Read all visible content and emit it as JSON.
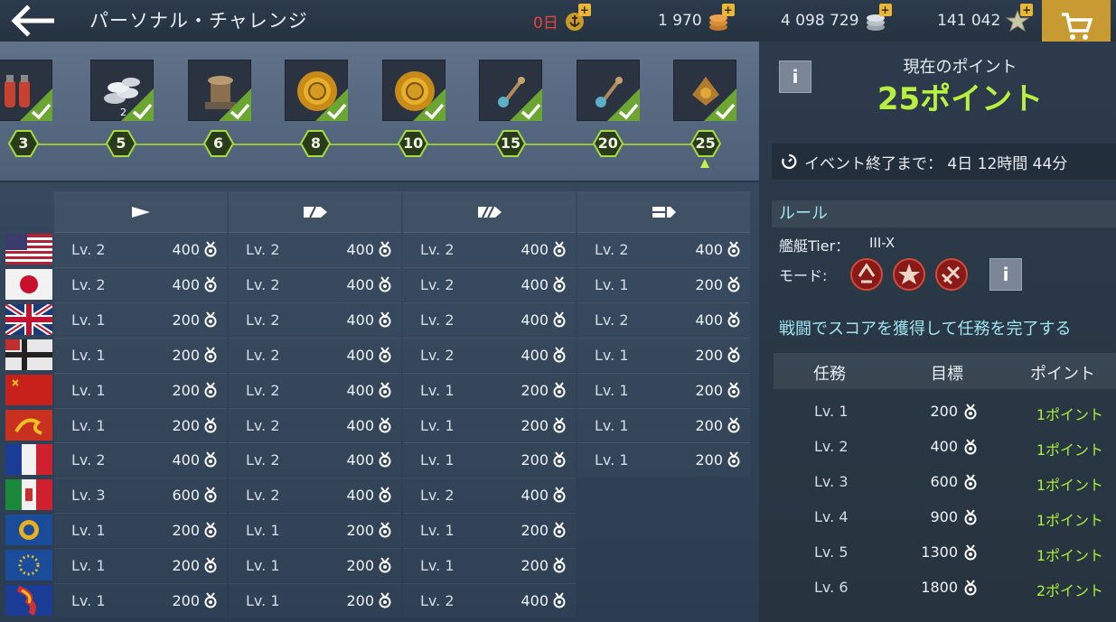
{
  "header": {
    "title": "パーソナル・チャレンジ",
    "currencies": [
      {
        "name": "premium-days",
        "value": "0日",
        "color": "#e8453a"
      },
      {
        "name": "doubloons",
        "value": "1 970",
        "color": "#e8edf3"
      },
      {
        "name": "credits",
        "value": "4 098 729",
        "color": "#e8edf3"
      },
      {
        "name": "free-xp",
        "value": "141 042",
        "color": "#e8edf3"
      }
    ]
  },
  "track": {
    "rewards": [
      {
        "icon": "consumables-icon",
        "count": ""
      },
      {
        "icon": "silver-coins-icon",
        "count": "2"
      },
      {
        "icon": "bollard-icon",
        "count": ""
      },
      {
        "icon": "gold-sun-emblem-icon",
        "count": ""
      },
      {
        "icon": "gold-sun-emblem-icon",
        "count": ""
      },
      {
        "icon": "signal-flag-icon",
        "count": ""
      },
      {
        "icon": "signal-flag-icon",
        "count": ""
      },
      {
        "icon": "container-icon",
        "count": ""
      }
    ],
    "milestones": [
      "3",
      "5",
      "6",
      "8",
      "10",
      "15",
      "20",
      "25"
    ],
    "accent": "#8fc83d"
  },
  "table": {
    "columns": [
      "destroyer-class-icon",
      "cruiser-class-icon",
      "battleship-class-icon",
      "carrier-class-icon"
    ],
    "rows": [
      {
        "flag": "usa",
        "cells": [
          [
            "Lv. 2",
            "400"
          ],
          [
            "Lv. 2",
            "400"
          ],
          [
            "Lv. 2",
            "400"
          ],
          [
            "Lv. 2",
            "400"
          ]
        ]
      },
      {
        "flag": "japan",
        "cells": [
          [
            "Lv. 2",
            "400"
          ],
          [
            "Lv. 2",
            "400"
          ],
          [
            "Lv. 2",
            "400"
          ],
          [
            "Lv. 1",
            "200"
          ]
        ]
      },
      {
        "flag": "uk",
        "cells": [
          [
            "Lv. 1",
            "200"
          ],
          [
            "Lv. 2",
            "400"
          ],
          [
            "Lv. 2",
            "400"
          ],
          [
            "Lv. 2",
            "400"
          ]
        ]
      },
      {
        "flag": "germany",
        "cells": [
          [
            "Lv. 1",
            "200"
          ],
          [
            "Lv. 2",
            "400"
          ],
          [
            "Lv. 2",
            "400"
          ],
          [
            "Lv. 1",
            "200"
          ]
        ]
      },
      {
        "flag": "ussr",
        "cells": [
          [
            "Lv. 1",
            "200"
          ],
          [
            "Lv. 2",
            "400"
          ],
          [
            "Lv. 1",
            "200"
          ],
          [
            "Lv. 1",
            "200"
          ]
        ]
      },
      {
        "flag": "pan-asia",
        "cells": [
          [
            "Lv. 1",
            "200"
          ],
          [
            "Lv. 2",
            "400"
          ],
          [
            "Lv. 1",
            "200"
          ],
          [
            "Lv. 1",
            "200"
          ]
        ]
      },
      {
        "flag": "france",
        "cells": [
          [
            "Lv. 2",
            "400"
          ],
          [
            "Lv. 2",
            "400"
          ],
          [
            "Lv. 1",
            "200"
          ],
          [
            "Lv. 1",
            "200"
          ]
        ]
      },
      {
        "flag": "italy",
        "cells": [
          [
            "Lv. 3",
            "600"
          ],
          [
            "Lv. 2",
            "400"
          ],
          [
            "Lv. 2",
            "400"
          ]
        ]
      },
      {
        "flag": "commonwealth",
        "cells": [
          [
            "Lv. 1",
            "200"
          ],
          [
            "Lv. 1",
            "200"
          ],
          [
            "Lv. 1",
            "200"
          ]
        ]
      },
      {
        "flag": "europe",
        "cells": [
          [
            "Lv. 1",
            "200"
          ],
          [
            "Lv. 1",
            "200"
          ],
          [
            "Lv. 1",
            "200"
          ]
        ]
      },
      {
        "flag": "pan-america",
        "cells": [
          [
            "Lv. 1",
            "200"
          ],
          [
            "Lv. 1",
            "200"
          ],
          [
            "Lv. 2",
            "400"
          ]
        ]
      }
    ]
  },
  "points": {
    "caption": "現在のポイント",
    "value": "25ポイント",
    "accent": "#b8f040"
  },
  "timer": {
    "text": "イベント終了まで： 4日 12時間 44分"
  },
  "rules": {
    "header": "ルール",
    "tier_label": "艦艇Tier：",
    "tier_value": "III-X",
    "mode_label": "モード:",
    "modes": [
      "random-battle-icon",
      "ranked-battle-icon",
      "operations-icon"
    ],
    "description": "戦闘でスコアを獲得して任務を完了する"
  },
  "missions": {
    "headers": [
      "任務",
      "目標",
      "ポイント"
    ],
    "rows": [
      [
        "Lv. 1",
        "200",
        "1ポイント"
      ],
      [
        "Lv. 2",
        "400",
        "1ポイント"
      ],
      [
        "Lv. 3",
        "600",
        "1ポイント"
      ],
      [
        "Lv. 4",
        "900",
        "1ポイント"
      ],
      [
        "Lv. 5",
        "1300",
        "1ポイント"
      ],
      [
        "Lv. 6",
        "1800",
        "2ポイント"
      ]
    ]
  }
}
